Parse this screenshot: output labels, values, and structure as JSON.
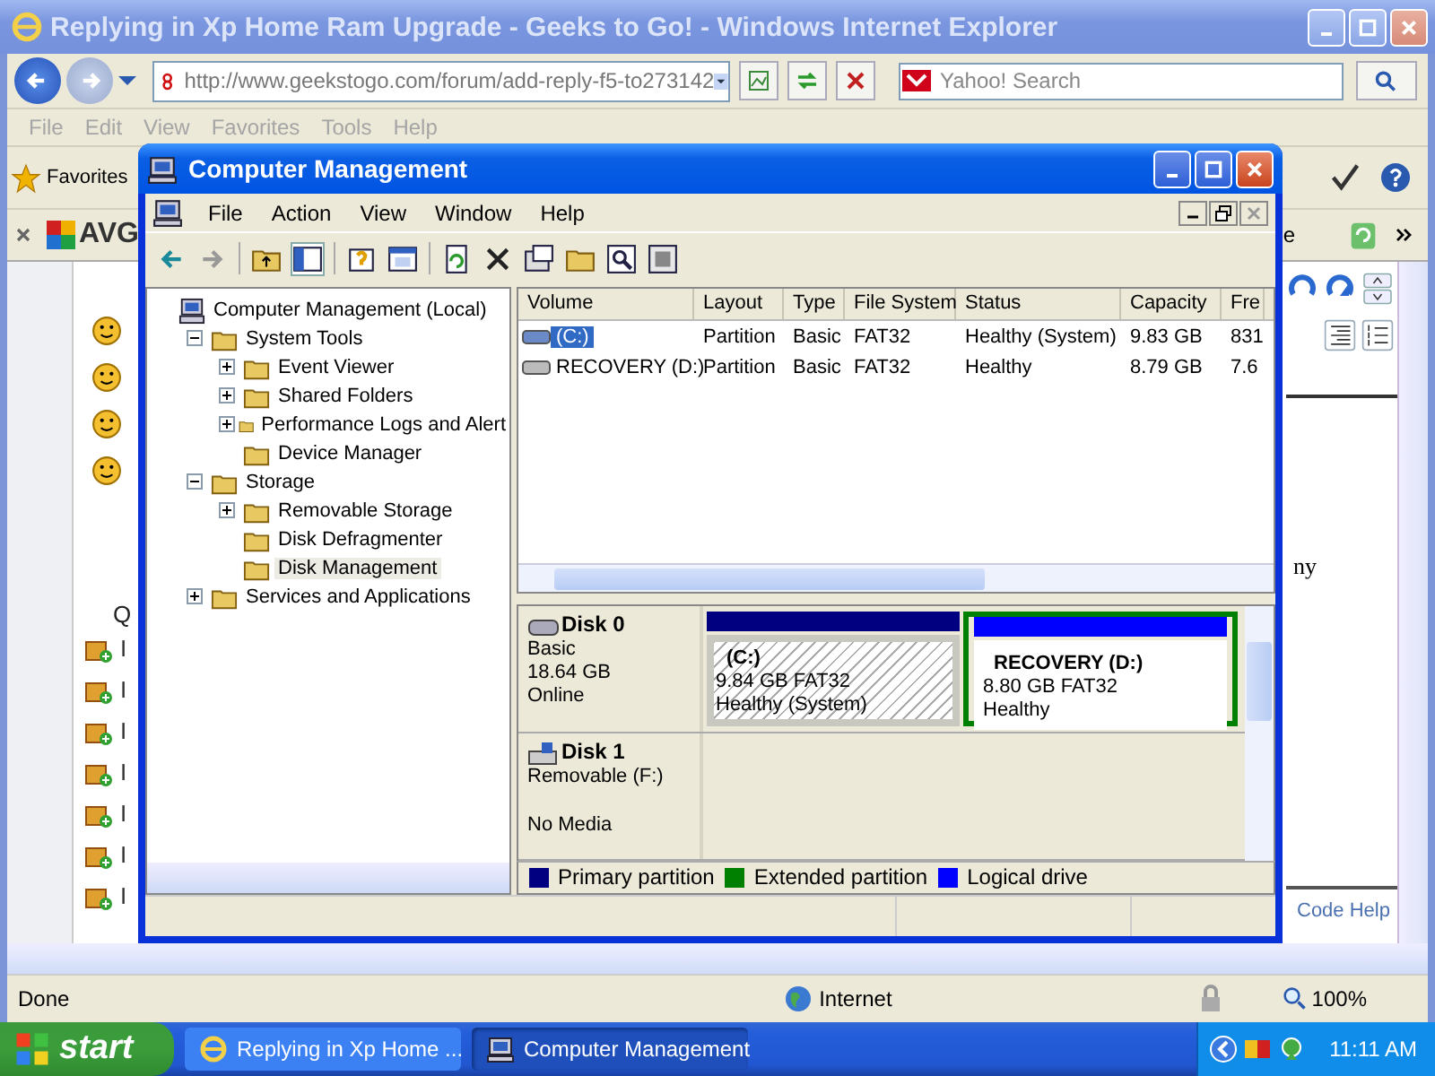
{
  "browser": {
    "title": "Replying in Xp Home Ram Upgrade - Geeks to Go! - Windows Internet Explorer",
    "address": "http://www.geekstogo.com/forum/add-reply-f5-to273142",
    "search": {
      "placeholder": "Yahoo! Search"
    },
    "menu": [
      "File",
      "Edit",
      "View",
      "Favorites",
      "Tools",
      "Help"
    ],
    "favorites_label": "Favorites",
    "toolbar_logo": "AVG",
    "toolbar_partial": "e",
    "sidebar": {
      "heading": "Q",
      "items": [
        "I",
        "I",
        "I",
        "I",
        "I",
        "I",
        "I"
      ]
    },
    "editor": {
      "text": "ny",
      "link": "Code Help"
    },
    "status_bar": {
      "text": "Done",
      "zone": "Internet",
      "zoom": "100%"
    }
  },
  "computer_management": {
    "title": "Computer Management",
    "menu": [
      "File",
      "Action",
      "View",
      "Window",
      "Help"
    ],
    "tree": [
      {
        "label": "Computer Management (Local)",
        "selected": false,
        "children": [
          {
            "label": "System Tools",
            "expanded": true,
            "selected": false,
            "children": [
              {
                "label": "Event Viewer",
                "expanded": false,
                "selected": false
              },
              {
                "label": "Shared Folders",
                "expanded": false,
                "selected": false
              },
              {
                "label": "Performance Logs and Alert",
                "expanded": false,
                "selected": false
              },
              {
                "label": "Device Manager",
                "selected": false
              }
            ]
          },
          {
            "label": "Storage",
            "expanded": true,
            "selected": false,
            "children": [
              {
                "label": "Removable Storage",
                "expanded": false,
                "selected": false
              },
              {
                "label": "Disk Defragmenter",
                "selected": false
              },
              {
                "label": "Disk Management",
                "selected": true
              }
            ]
          },
          {
            "label": "Services and Applications",
            "expanded": false,
            "selected": false
          }
        ]
      }
    ],
    "volumes": {
      "columns": [
        "Volume",
        "Layout",
        "Type",
        "File System",
        "Status",
        "Capacity",
        "Fre"
      ],
      "rows": [
        {
          "cells": [
            "(C:)",
            "Partition",
            "Basic",
            "FAT32",
            "Healthy (System)",
            "9.83 GB",
            "831"
          ],
          "selected": true
        },
        {
          "cells": [
            "RECOVERY (D:)",
            "Partition",
            "Basic",
            "FAT32",
            "Healthy",
            "8.79 GB",
            "7.6"
          ],
          "selected": false
        }
      ]
    },
    "disks": [
      {
        "name": "Disk 0",
        "kind": "basic",
        "details": [
          "Basic",
          "18.64 GB"
        ],
        "status": "Online",
        "partitions": [
          {
            "name": "(C:)",
            "details": [
              "9.84 GB FAT32",
              "Healthy (System)"
            ],
            "color": "#000080",
            "in_extended": false,
            "selected": true
          },
          {
            "name": "RECOVERY  (D:)",
            "details": [
              "8.80 GB FAT32",
              "Healthy"
            ],
            "color": "#0000ff",
            "in_extended": true,
            "selected": false
          }
        ]
      },
      {
        "name": "Disk 1",
        "kind": "removable",
        "details": [
          "Removable (F:)"
        ],
        "status": "No Media"
      }
    ],
    "legend": [
      {
        "label": "Primary partition",
        "color": "#000080"
      },
      {
        "label": "Extended partition",
        "color": "#008000"
      },
      {
        "label": "Logical drive",
        "color": "#0000ff"
      }
    ]
  },
  "taskbar": {
    "start": "start",
    "tasks": [
      {
        "label": "Replying in Xp Home ...",
        "kind": "browser",
        "selected": false
      },
      {
        "label": "Computer Management",
        "kind": "computer",
        "selected": true
      }
    ],
    "clock": "11:11 AM"
  }
}
